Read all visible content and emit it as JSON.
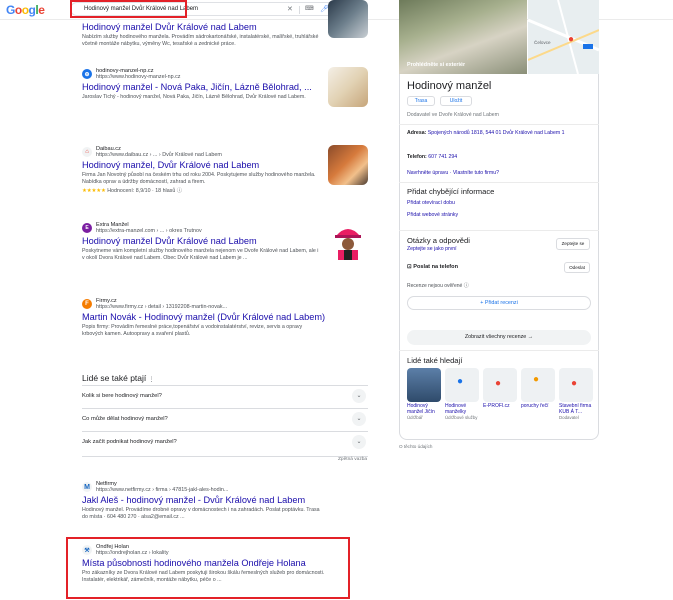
{
  "header": {
    "logo_letters": [
      "G",
      "o",
      "o",
      "g",
      "l",
      "e"
    ],
    "query": "Hodinový manžel Dvůr Králové nad Labem",
    "icons": [
      "close-icon",
      "keyboard-icon",
      "mic-icon",
      "lens-icon",
      "search-icon"
    ]
  },
  "results": [
    {
      "title": "Hodinový manžel Dvůr Králové nad Labem",
      "snippet": "Nabízím služby hodinového manžela. Provádím sádrokartonářské, instalatérské, malířské, truhlářské včetně montáže nábytku, výměny Wc, tesařské a zednické práce."
    },
    {
      "site_name": "hodinovy-manzel-np.cz",
      "url": "https://www.hodinovy-manzel-np.cz",
      "title": "Hodinový manžel - Nová Paka, Jičín, Lázně Bělohrad, ...",
      "snippet": "Jaroslav Tichý - hodinový manžel, Nová Paka, Jičín, Lázně Bělohrad, Dvůr Králové nad Labem."
    },
    {
      "site_name": "Daibau.cz",
      "url": "https://www.daibau.cz › ... › Dvůr Králové nad Labem",
      "title": "Hodinový manžel, Dvůr Králové nad Labem",
      "snippet": "Firma Jan Novotný působí na českém trhu od roku 2004. Poskytujeme služby hodinového manžela. Nabídka oprav a údržby domácností, zahrad a firem.",
      "stars": "★★★★★",
      "rating": "Hodnocení: 8,9/10 · 18 hlasů"
    },
    {
      "site_name": "Extra Manžel",
      "url": "https://extra-manzel.com › ... › okres Trutnov",
      "title": "Hodinový manžel Dvůr Králové nad Labem",
      "snippet": "Poskytneme vám kompletní služby hodinového manžela nejenom ve Dvoře Králové nad Labem, ale i v okolí Dvora Králové nad Labem. Obec Dvůr Králové nad Labem je ..."
    },
    {
      "site_name": "Firmy.cz",
      "url": "https://www.firmy.cz › detail › 13192208-martin-novak...",
      "title": "Martin Novák - Hodinový manžel (Dvůr Králové nad Labem)",
      "snippet": "Popis firmy: Provádím řemeslné práce,topenářství a vodoinstalatérství, revize, servis a opravy krbových kamen. Autoopravy a svaření plastů."
    },
    {
      "site_name": "Netfirmy",
      "url": "https://www.netfirmy.cz › firma › 47815-jakl-ales-hodin...",
      "title": "Jakl Aleš - hodinový manžel - Dvůr Králové nad Labem",
      "snippet": "Hodinový manžel. Provádíme drobné opravy v domácnostech i na zahradách. Poslat poptávku. Trasa do místa · 604 480 270 · alsa2@email.cz ..."
    },
    {
      "site_name": "Ondřej Holan",
      "url": "https://ondrejholan.cz › lokality",
      "title": "Místa působnosti hodinového manžela Ondřeje Holana",
      "snippet": "Pro zákazníky ze Dvora Králové nad Labem poskytuji širokou škálu řemeslných služeb pro domácnosti. Instalatér, elektrikář, zámečník, montáže nábytku, péče o ..."
    }
  ],
  "paa": {
    "title": "Lidé se také ptají",
    "questions": [
      "Kolik si bere hodinový manžel?",
      "Co může dělat hodinový manžel?",
      "Jak začít podnikat hodinový manžel?"
    ],
    "feedback": "Zpětná vazba"
  },
  "kp": {
    "photo_label": "Prohlédněte si exteriér",
    "map_label": "Čelovce",
    "title": "Hodinový manžel",
    "route": "Trasa",
    "save": "Uložit",
    "category": "Dodavatel ve Dvoře Králové nad Labem",
    "address_label": "Adresa:",
    "address": "Spojených národů 1818, 544 01 Dvůr Králové nad Labem 1",
    "phone_label": "Telefon:",
    "phone": "607 741 294",
    "suggest": "Navrhněte úpravu · Vlastníte tuto firmu?",
    "missing_title": "Přidat chybějící informace",
    "add_hours": "Přidat otevírací dobu",
    "add_website": "Přidat webové stránky",
    "qa_title": "Otázky a odpovědi",
    "qa_link": "Zeptejte se jako první",
    "ask_btn": "Zeptejte se",
    "send_phone": "Poslat na telefon",
    "send_btn": "Odeslat",
    "reviews_verified": "Recenze nejsou ověřené",
    "add_review": "Přidat recenzi",
    "all_reviews": "Zobrazit všechny recenze",
    "pasf_title": "Lidé také hledají",
    "pasf": [
      {
        "name": "Hodinový manžel Jičín",
        "sub": "Údržbář"
      },
      {
        "name": "Hodinové manželky",
        "sub": "Údržbové služby"
      },
      {
        "name": "E-PROFI.cz",
        "sub": ""
      },
      {
        "name": "poruchy řečí",
        "sub": ""
      },
      {
        "name": "Stavební firma KUB Á T...",
        "sub": "Dodavatel"
      }
    ],
    "about": "O těchto údajích"
  }
}
